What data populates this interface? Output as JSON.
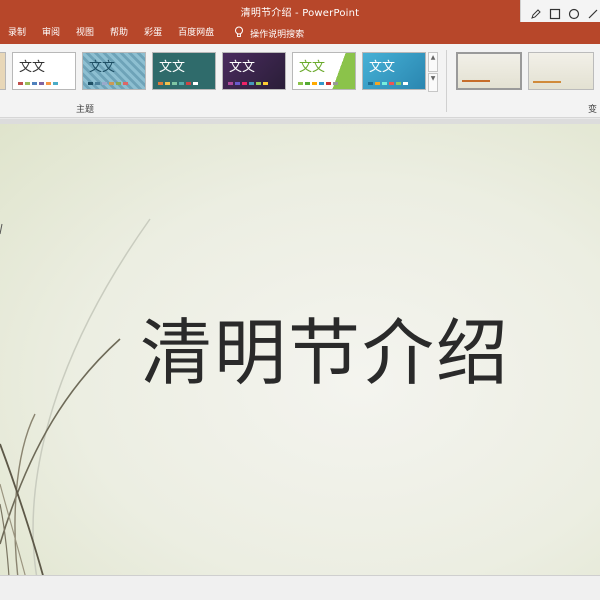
{
  "window": {
    "title": "清明节介绍 - PowerPoint"
  },
  "draw_tools": [
    {
      "name": "pen-icon"
    },
    {
      "name": "rectangle-icon"
    },
    {
      "name": "circle-icon"
    },
    {
      "name": "arrow-icon"
    }
  ],
  "menu": {
    "tabs": [
      "录制",
      "审阅",
      "视图",
      "帮助",
      "彩蛋",
      "百度网盘"
    ],
    "tell_me": "操作说明搜索",
    "tell_me_icon": "lightbulb-icon"
  },
  "ribbon": {
    "themes_group_label": "主题",
    "variants_group_label": "变",
    "theme_sample_text": "文文",
    "themes": [
      {
        "bg": "#ffffff",
        "text": "#333333",
        "accent": "#c0504d"
      },
      {
        "bg": "#7fb3c8",
        "text": "#1d4e63",
        "accent": "#4a7f99"
      },
      {
        "bg": "#2f6b6b",
        "text": "#ffffff",
        "accent": "#e07b39"
      },
      {
        "bg": "#3a2d4a",
        "text": "#ffffff",
        "accent": "#b04a9a"
      },
      {
        "bg": "#ffffff",
        "text": "#6aaa2c",
        "accent": "#8bc34a"
      },
      {
        "bg": "#3aa0c8",
        "text": "#ffffff",
        "accent": "#1f6f94"
      }
    ],
    "scroll_up": "▲",
    "scroll_down": "▼",
    "variants": [
      {
        "selected": true
      },
      {
        "selected": false
      },
      {
        "selected": false
      }
    ]
  },
  "slide": {
    "title": "清明节介绍"
  }
}
